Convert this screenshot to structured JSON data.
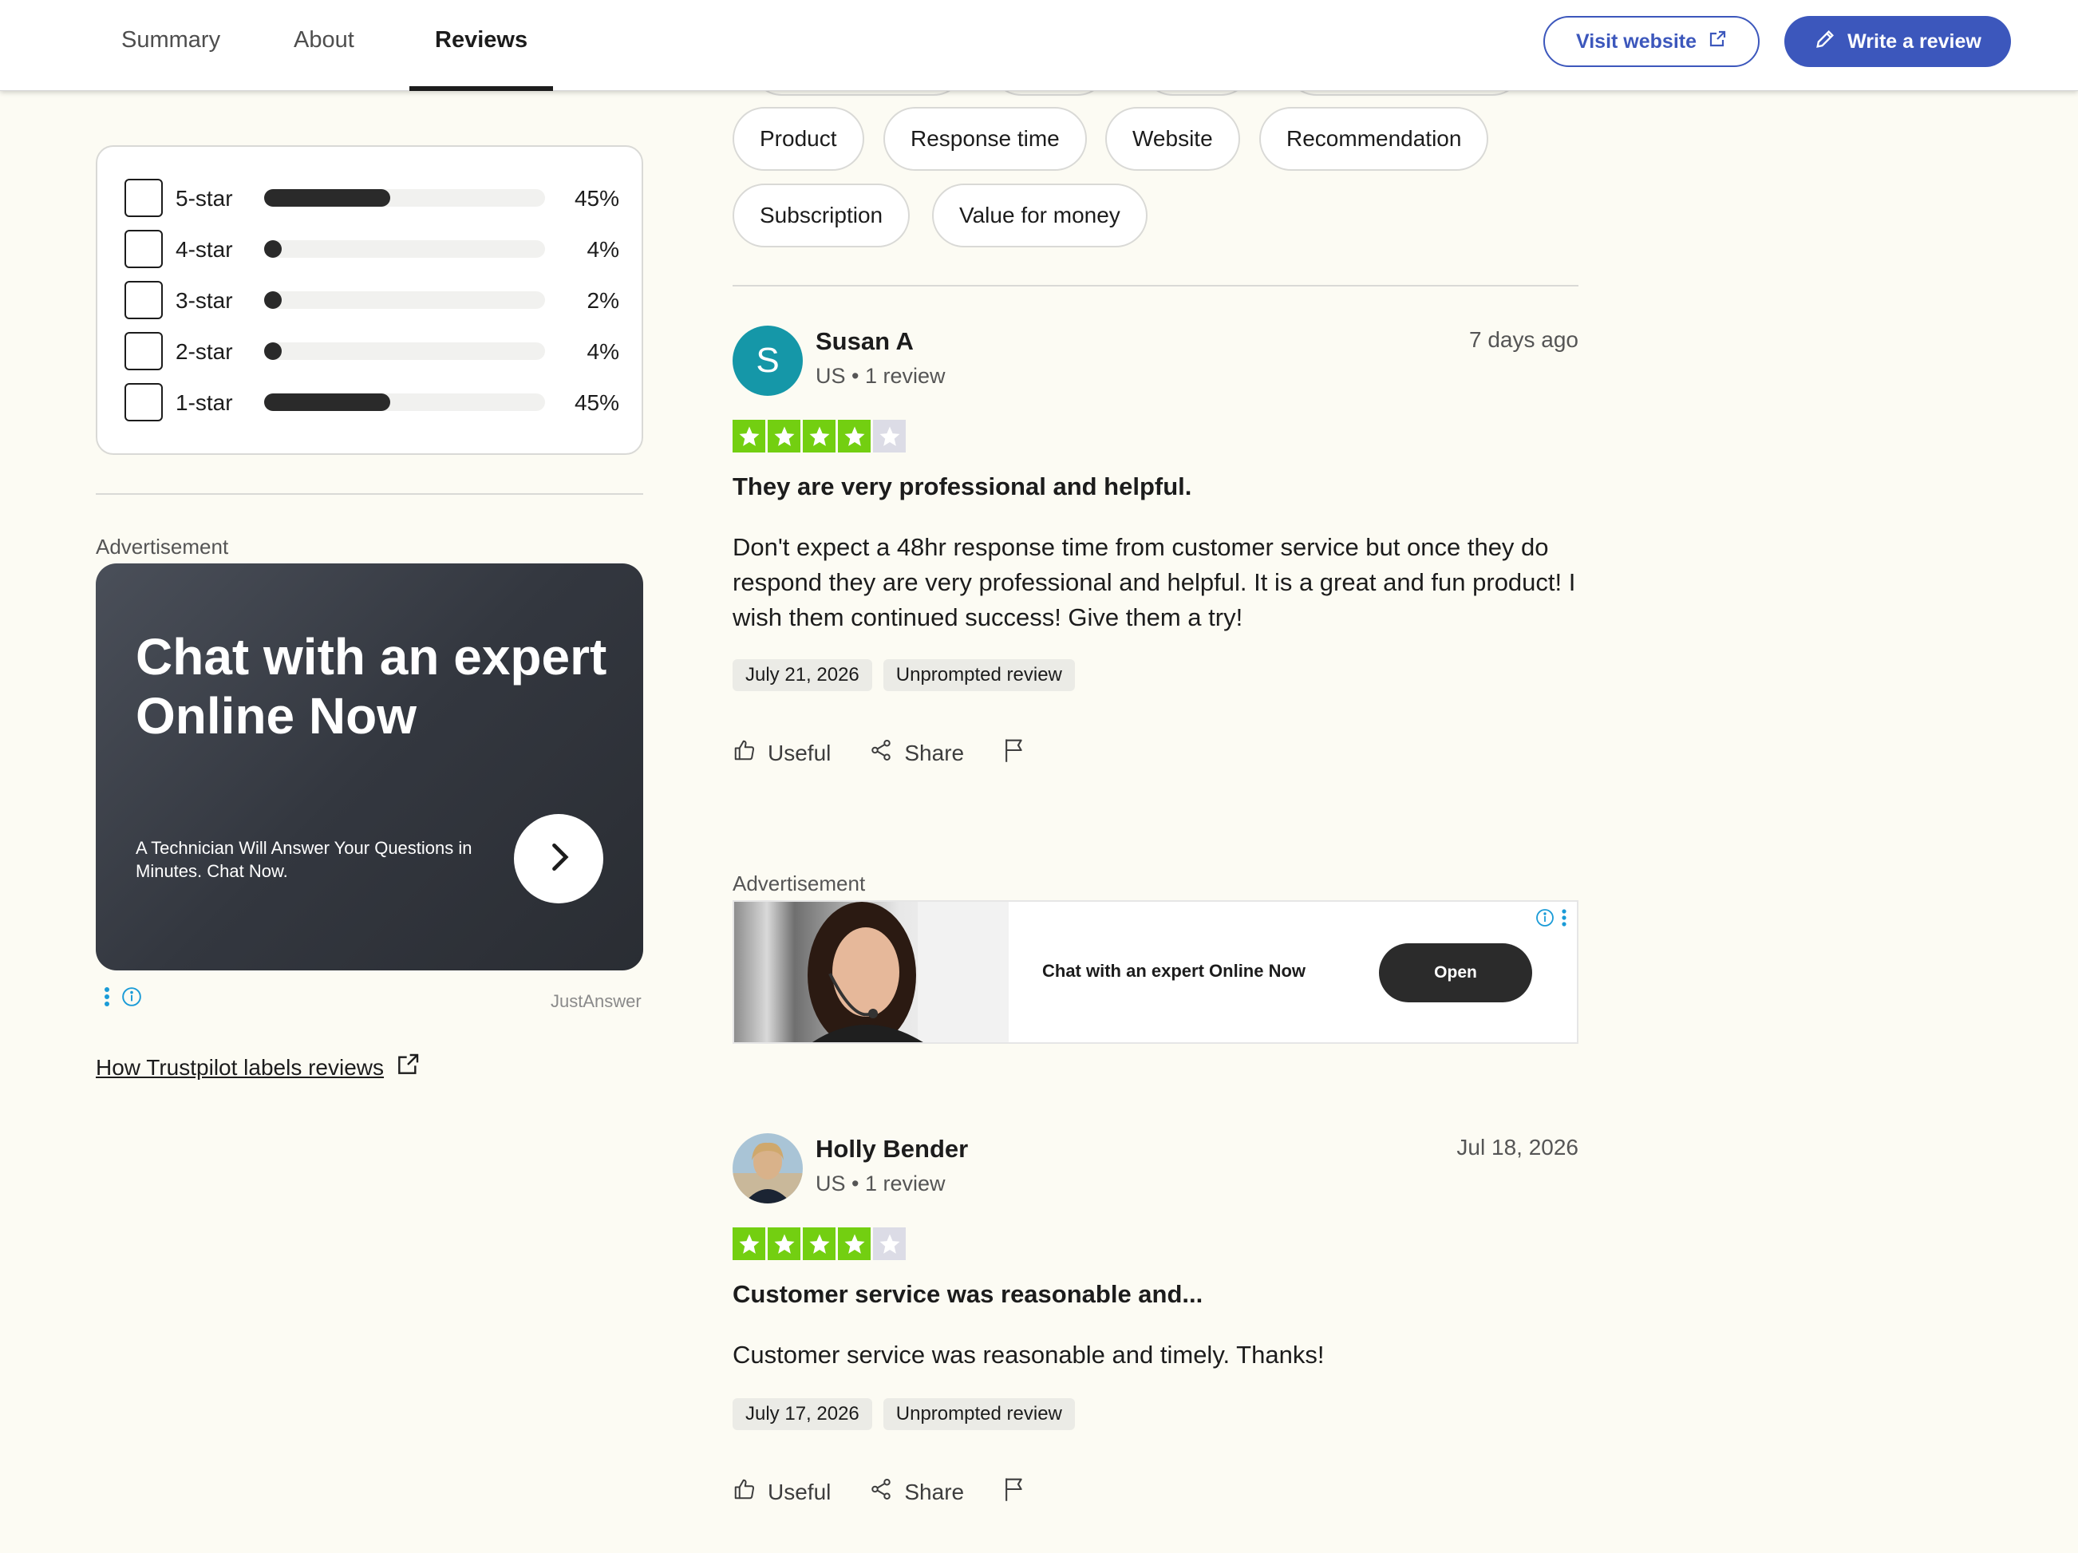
{
  "nav": {
    "tabs": [
      {
        "label": "Summary",
        "active": false
      },
      {
        "label": "About",
        "active": false
      },
      {
        "label": "Reviews",
        "active": true
      }
    ],
    "visit_website": "Visit website",
    "write_review": "Write a review"
  },
  "rating_filter": [
    {
      "label": "5-star",
      "percent": 45,
      "display": "45%"
    },
    {
      "label": "4-star",
      "percent": 4,
      "display": "4%"
    },
    {
      "label": "3-star",
      "percent": 2,
      "display": "2%"
    },
    {
      "label": "2-star",
      "percent": 4,
      "display": "4%"
    },
    {
      "label": "1-star",
      "percent": 45,
      "display": "45%"
    }
  ],
  "sidebar_ad": {
    "label": "Advertisement",
    "headline": "Chat with an expert Online Now",
    "subtext": "A Technician Will Answer Your Questions in Minutes. Chat Now.",
    "brand": "JustAnswer"
  },
  "labels_link": "How Trustpilot labels reviews",
  "topic_chips": [
    "Product",
    "Response time",
    "Website",
    "Recommendation",
    "Subscription",
    "Value for money"
  ],
  "reviews": [
    {
      "name": "Susan A",
      "avatar_letter": "S",
      "meta": "US • 1 review",
      "date": "7 days ago",
      "rating": 4,
      "title": "They are very professional and helpful.",
      "body": "Don't expect a 48hr response time from customer service but once they do respond they are very professional and helpful. It is a great and fun product! I wish them continued success! Give them a try!",
      "experience_date": "July 21, 2026",
      "label": "Unprompted review",
      "useful": "Useful",
      "share": "Share"
    },
    {
      "name": "Holly Bender",
      "meta": "US • 1 review",
      "date": "Jul 18, 2026",
      "rating": 4,
      "title": "Customer service was reasonable and...",
      "body": "Customer service was reasonable and timely. Thanks!",
      "experience_date": "July 17, 2026",
      "label": "Unprompted review",
      "useful": "Useful",
      "share": "Share"
    }
  ],
  "inline_ad": {
    "label": "Advertisement",
    "text": "Chat with an expert Online Now",
    "button": "Open"
  },
  "colors": {
    "brand_blue": "#3c57bc",
    "star_green": "#73cf11",
    "star_empty": "#dcdce6",
    "avatar_teal": "#1597a8",
    "background": "#fcfbf3"
  },
  "icons": [
    "external-link-icon",
    "pencil-icon",
    "thumbs-up-icon",
    "share-icon",
    "flag-icon",
    "chevron-right-icon",
    "info-icon",
    "kebab-menu-icon",
    "star-icon"
  ]
}
